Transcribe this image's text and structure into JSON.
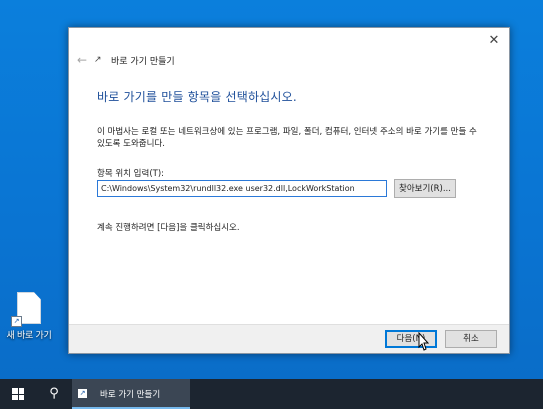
{
  "desktop": {
    "shortcut_label": "새 바로 가기"
  },
  "dialog": {
    "title": "바로 가기 만들기",
    "heading": "바로 가기를 만들 항목을 선택하십시오.",
    "description": "이 마법사는 로컬 또는 네트워크상에 있는 프로그램, 파일, 폴더, 컴퓨터, 인터넷 주소의 바로 가기를 만들 수 있도록 도와줍니다.",
    "location_label": "항목 위치 입력(T):",
    "location_value": "C:\\Windows\\System32\\rundll32.exe user32.dll,LockWorkStation",
    "browse_label": "찾아보기(R)...",
    "continue_text": "계속 진행하려면 [다음]을 클릭하십시오.",
    "next_label": "다음(N)",
    "cancel_label": "취소",
    "close_glyph": "✕",
    "back_glyph": "←"
  },
  "taskbar": {
    "search_glyph": "⚲",
    "active_item_label": "바로 가기 만들기"
  },
  "icons": {
    "close": "close-icon",
    "back": "back-arrow-icon",
    "shortcut": "shortcut-icon",
    "windows": "windows-logo-icon",
    "search": "search-icon"
  },
  "colors": {
    "desktop_bg": "#0a78d7",
    "heading": "#1e4f9a",
    "accent": "#0078d7",
    "taskbar": "#1c2530"
  }
}
